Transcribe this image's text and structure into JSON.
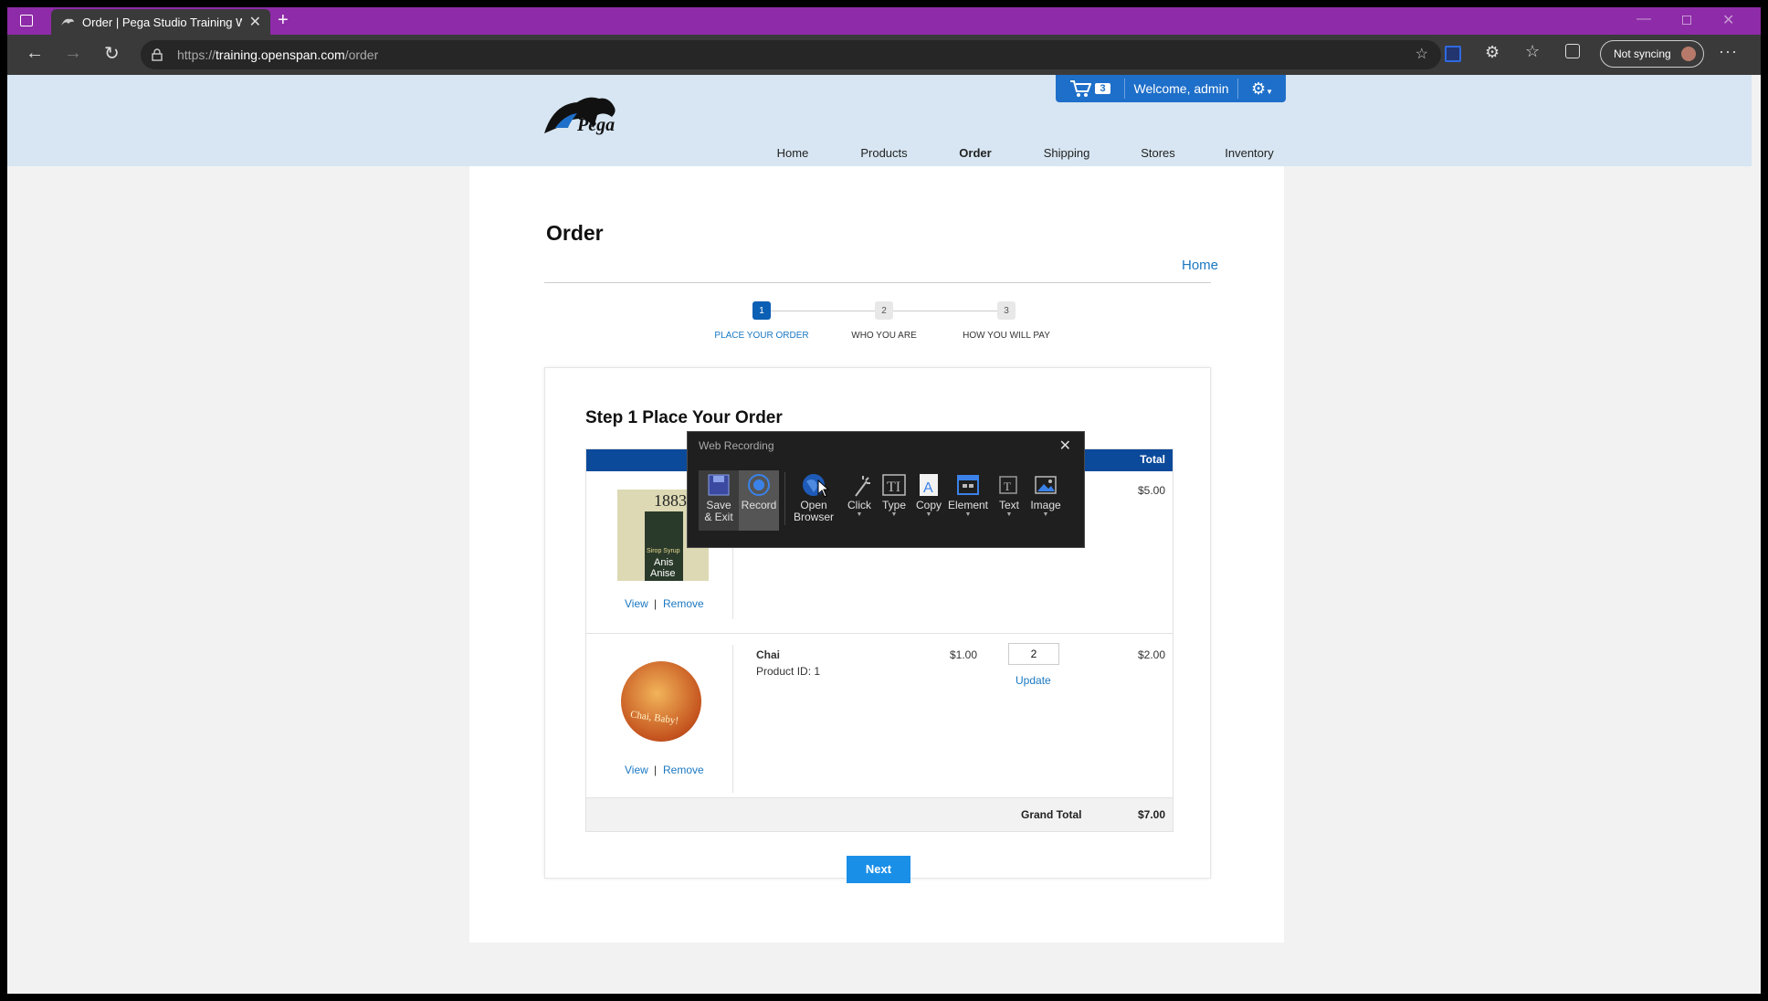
{
  "browser": {
    "tab_title": "Order | Pega Studio Training Wel",
    "url_prefix": "https://",
    "url_host": "training.openspan.com",
    "url_path": "/order",
    "sync_label": "Not syncing"
  },
  "header": {
    "logo_text": "Pega",
    "cart_count": "3",
    "welcome": "Welcome, admin",
    "nav": [
      "Home",
      "Products",
      "Order",
      "Shipping",
      "Stores",
      "Inventory"
    ],
    "active_nav": "Order"
  },
  "page": {
    "title": "Order",
    "home_link": "Home",
    "steps": [
      {
        "number": "1",
        "label": "PLACE YOUR ORDER",
        "active": true
      },
      {
        "number": "2",
        "label": "WHO YOU ARE",
        "active": false
      },
      {
        "number": "3",
        "label": "HOW YOU WILL PAY",
        "active": false
      }
    ]
  },
  "order": {
    "heading": "Step 1 Place Your Order",
    "column_total": "Total",
    "items": [
      {
        "total": "$5.00",
        "image_text": [
          "1883",
          "Sirop Syrup",
          "Anis",
          "Anise"
        ],
        "view": "View",
        "remove": "Remove"
      },
      {
        "name": "Chai",
        "product_id": "Product ID: 1",
        "price": "$1.00",
        "quantity": "2",
        "update": "Update",
        "total": "$2.00",
        "image_text": "Chai, Baby!",
        "view": "View",
        "remove": "Remove"
      }
    ],
    "grand_total_label": "Grand Total",
    "grand_total": "$7.00",
    "next_label": "Next",
    "separator": "|"
  },
  "recorder": {
    "title": "Web Recording",
    "tools": [
      {
        "label": "Save\n& Exit",
        "icon": "save-icon"
      },
      {
        "label": "Record",
        "icon": "record-icon"
      },
      {
        "label": "Open\nBrowser",
        "icon": "globe-icon"
      },
      {
        "label": "Click",
        "icon": "click-icon"
      },
      {
        "label": "Type",
        "icon": "type-icon"
      },
      {
        "label": "Copy",
        "icon": "copy-icon"
      },
      {
        "label": "Element",
        "icon": "element-icon"
      },
      {
        "label": "Text",
        "icon": "text-icon"
      },
      {
        "label": "Image",
        "icon": "image-icon"
      }
    ]
  },
  "colors": {
    "titlebar": "#8e2ba8",
    "header": "#d7e6f2",
    "accent": "#1e6fc9",
    "table_header": "#0b4a9b",
    "next_button": "#1a8fe8"
  }
}
